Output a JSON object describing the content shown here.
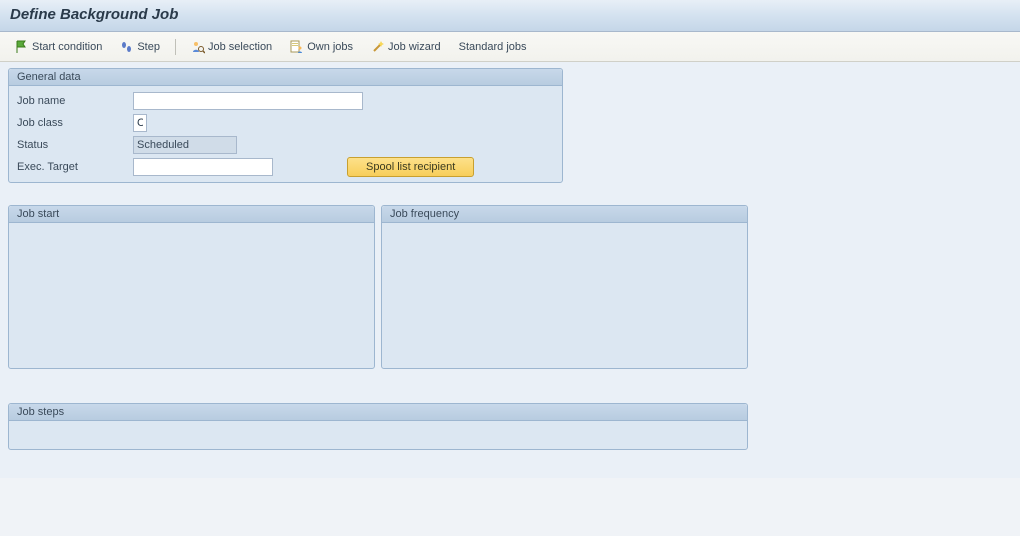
{
  "title": "Define Background Job",
  "toolbar": {
    "start_condition": "Start condition",
    "step": "Step",
    "job_selection": "Job selection",
    "own_jobs": "Own jobs",
    "job_wizard": "Job wizard",
    "standard_jobs": "Standard jobs"
  },
  "general": {
    "title": "General data",
    "job_name_label": "Job name",
    "job_name_value": "",
    "job_class_label": "Job class",
    "job_class_value": "C",
    "status_label": "Status",
    "status_value": "Scheduled",
    "exec_target_label": "Exec. Target",
    "exec_target_value": "",
    "spool_btn": "Spool list recipient"
  },
  "job_start": {
    "title": "Job start"
  },
  "job_frequency": {
    "title": "Job frequency"
  },
  "job_steps": {
    "title": "Job steps"
  }
}
